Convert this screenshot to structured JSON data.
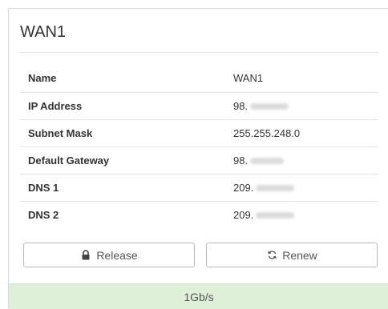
{
  "card": {
    "title": "WAN1"
  },
  "info": {
    "rows": [
      {
        "label": "Name",
        "value": "WAN1",
        "redacted": false
      },
      {
        "label": "IP Address",
        "value": "98.",
        "redacted": true
      },
      {
        "label": "Subnet Mask",
        "value": "255.255.248.0",
        "redacted": false
      },
      {
        "label": "Default Gateway",
        "value": "98.",
        "redacted": true
      },
      {
        "label": "DNS 1",
        "value": "209.",
        "redacted": true
      },
      {
        "label": "DNS 2",
        "value": "209.",
        "redacted": true
      }
    ]
  },
  "actions": {
    "release_label": "Release",
    "release_icon": "lock-icon",
    "renew_label": "Renew",
    "renew_icon": "refresh-icon"
  },
  "status": {
    "speed": "1Gb/s",
    "color": "#dff0d8"
  }
}
